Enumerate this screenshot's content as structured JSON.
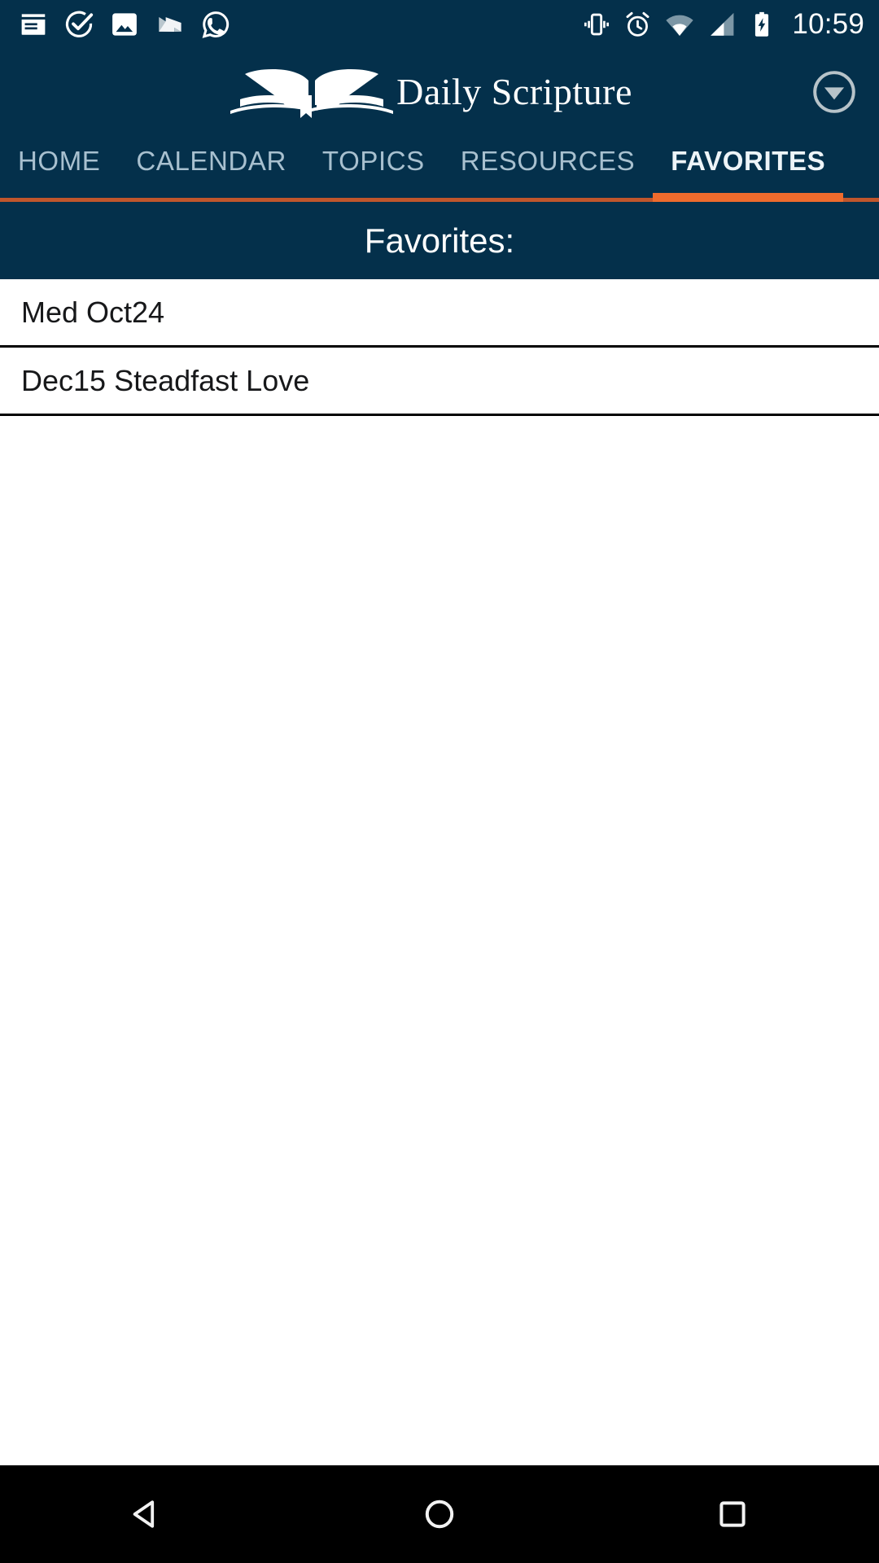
{
  "status_bar": {
    "time": "10:59",
    "left_icons": [
      {
        "name": "notes-icon",
        "label": "Notes"
      },
      {
        "name": "task-check-icon",
        "label": "Tasks"
      },
      {
        "name": "photos-icon",
        "label": "Photos"
      },
      {
        "name": "nougat-icon",
        "label": "N"
      },
      {
        "name": "whatsapp-icon",
        "label": "WhatsApp"
      }
    ],
    "right_icons": [
      {
        "name": "vibrate-icon",
        "label": "Vibrate"
      },
      {
        "name": "alarm-icon",
        "label": "Alarm"
      },
      {
        "name": "wifi-icon",
        "label": "Wi-Fi"
      },
      {
        "name": "signal-icon",
        "label": "Signal"
      },
      {
        "name": "battery-charging-icon",
        "label": "Battery charging"
      }
    ]
  },
  "app_bar": {
    "title": "Daily Scripture",
    "logo_name": "open-book-icon",
    "overflow_name": "chevron-down-circle-icon"
  },
  "tabs": [
    {
      "label": "HOME",
      "active": false
    },
    {
      "label": "CALENDAR",
      "active": false
    },
    {
      "label": "TOPICS",
      "active": false
    },
    {
      "label": "RESOURCES",
      "active": false
    },
    {
      "label": "FAVORITES",
      "active": true
    }
  ],
  "section": {
    "title": "Favorites:"
  },
  "favorites": [
    {
      "label": "Med Oct24"
    },
    {
      "label": "Dec15 Steadfast Love"
    }
  ],
  "nav_bar": {
    "back_label": "Back",
    "home_label": "Home",
    "recents_label": "Recents"
  },
  "colors": {
    "header_blue": "#04304b",
    "accent_orange": "#ee6b2d",
    "accent_orange_dim": "#c0562c",
    "tab_inactive": "#a8c0cf",
    "list_text": "#17181a",
    "nav_background": "#000000"
  }
}
